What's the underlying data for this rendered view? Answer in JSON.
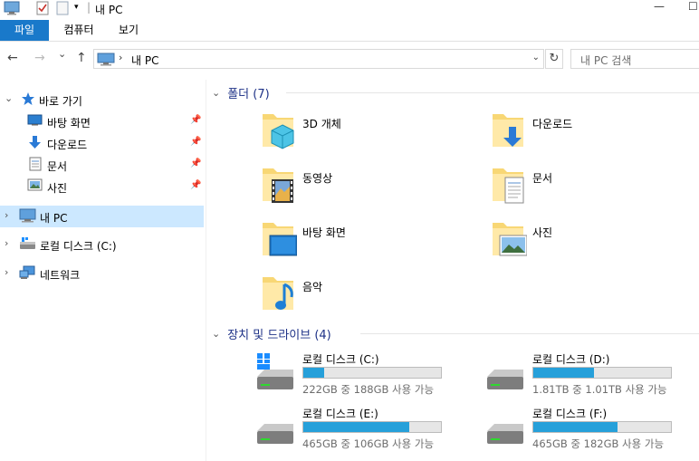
{
  "window": {
    "title": "내 PC",
    "minimize": "—",
    "maximize": "☐"
  },
  "ribbon": {
    "tabs": [
      "파일",
      "컴퓨터",
      "보기"
    ]
  },
  "address": {
    "separator": "›",
    "path": "내 PC",
    "dropdown": "⌄",
    "refresh": "↻",
    "search_placeholder": "내 PC 검색"
  },
  "nav": {
    "back": "←",
    "forward": "→",
    "recent": "⌄",
    "up": "↑"
  },
  "navpane": {
    "quick_access": "바로 가기",
    "items": [
      {
        "label": "바탕 화면",
        "icon": "desktop-icon"
      },
      {
        "label": "다운로드",
        "icon": "download-icon"
      },
      {
        "label": "문서",
        "icon": "document-icon"
      },
      {
        "label": "사진",
        "icon": "pictures-icon"
      }
    ],
    "this_pc": "내 PC",
    "local_disk": "로컬 디스크 (C:)",
    "network": "네트워크",
    "pin": "📌"
  },
  "folders": {
    "header": "폴더 (7)",
    "items": [
      "3D 개체",
      "다운로드",
      "동영상",
      "문서",
      "바탕 화면",
      "사진",
      "음악"
    ]
  },
  "drives": {
    "header": "장치 및 드라이브 (4)",
    "items": [
      {
        "name": "로컬 디스크 (C:)",
        "info": "222GB 중 188GB 사용 가능",
        "used_fraction": 0.153
      },
      {
        "name": "로컬 디스크 (D:)",
        "info": "1.81TB 중 1.01TB 사용 가능",
        "used_fraction": 0.442
      },
      {
        "name": "로컬 디스크 (E:)",
        "info": "465GB 중 106GB 사용 가능",
        "used_fraction": 0.772
      },
      {
        "name": "로컬 디스크 (F:)",
        "info": "465GB 중 182GB 사용 가능",
        "used_fraction": 0.609
      }
    ]
  },
  "colors": {
    "accent": "#1979ca",
    "selection": "#cce8ff",
    "section_header": "#1e3287",
    "drive_bar": "#26a0da"
  }
}
